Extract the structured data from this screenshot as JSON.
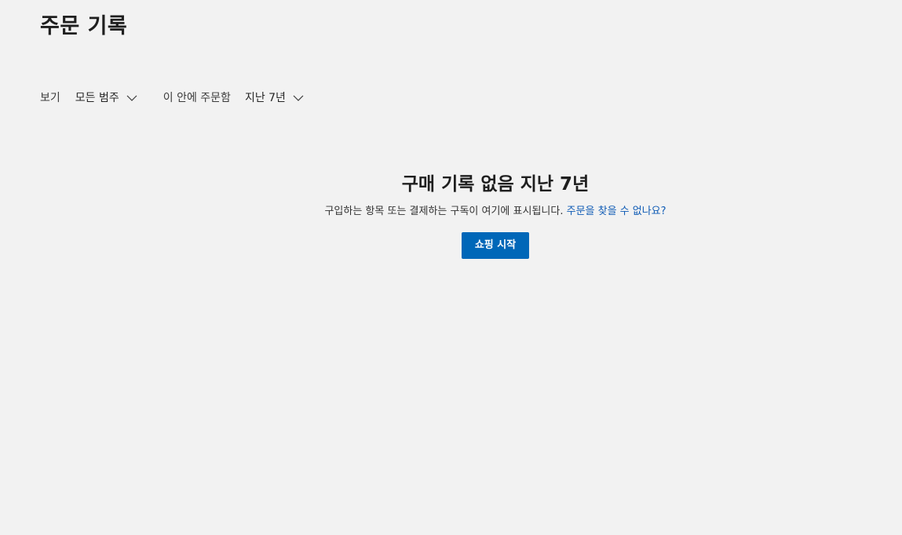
{
  "header": {
    "title": "주문 기록"
  },
  "filters": {
    "view_label": "보기",
    "category": {
      "selected": "모든 범주",
      "icon": "chevron-down-icon"
    },
    "ordered_in_label": "이 안에 주문함",
    "period": {
      "selected": "지난 7년",
      "icon": "chevron-down-icon"
    }
  },
  "empty_state": {
    "title": "구매 기록 없음 지난 7년",
    "description": "구입하는 항목 또는 결제하는 구독이 여기에 표시됩니다.",
    "help_link": "주문을 찾을 수 없나요?",
    "cta_label": "쇼핑 시작"
  },
  "colors": {
    "background": "#f2f2f2",
    "accent": "#0067b8",
    "link": "#0f5bb5",
    "text": "#1f1f1f"
  }
}
